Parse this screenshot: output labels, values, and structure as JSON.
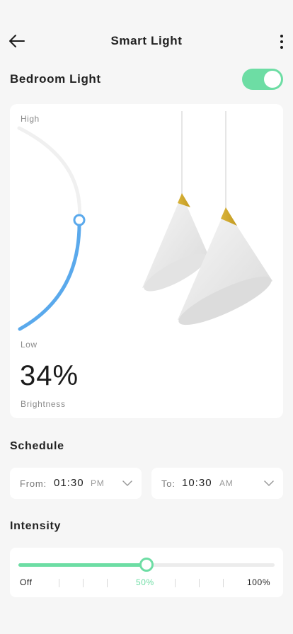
{
  "header": {
    "title": "Smart Light",
    "back_icon": "arrow-left-icon",
    "menu_icon": "more-vertical-icon"
  },
  "device": {
    "name": "Bedroom Light",
    "power_on": true
  },
  "brightness": {
    "high_label": "High",
    "low_label": "Low",
    "value_text": "34%",
    "value": 34,
    "caption": "Brightness"
  },
  "schedule": {
    "title": "Schedule",
    "from": {
      "label": "From:",
      "time": "01:30",
      "period": "PM"
    },
    "to": {
      "label": "To:",
      "time": "10:30",
      "period": "AM"
    }
  },
  "intensity": {
    "title": "Intensity",
    "value_percent": 50,
    "min_label": "Off",
    "mid_label": "50%",
    "max_label": "100%"
  },
  "colors": {
    "accent_green": "#6ddda4",
    "arc_blue": "#5aa9ec",
    "background": "#f6f6f6"
  }
}
